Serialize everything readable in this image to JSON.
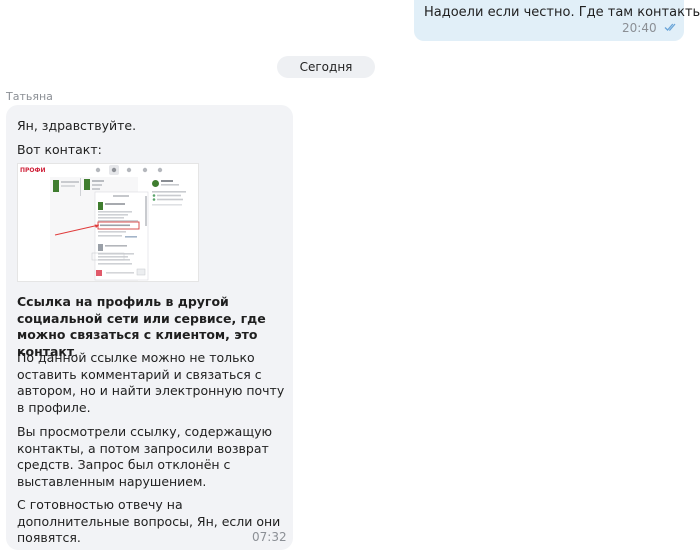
{
  "outgoing": {
    "text": "Надоели если честно. Где там контакты?",
    "time": "20:40",
    "status_icon": "double-check-icon",
    "bubble_color": "#e1eff8",
    "check_color": "#6aa5d8"
  },
  "date_divider": "Сегодня",
  "incoming": {
    "sender": "Татьяна",
    "greeting": "Ян, здравствуйте.",
    "intro": "Вот контакт:",
    "image": {
      "brand": "ПРОФИ",
      "accent_color": "#d0233b"
    },
    "bold_paragraph": "Ссылка на профиль в другой социальной сети или сервисе, где можно связаться с клиентом, это контакт",
    "bold_suffix": ".",
    "paragraph_1": "По данной ссылке можно не только оставить комментарий и связаться с автором, но и найти электронную почту в профиле.",
    "paragraph_2": "Вы просмотрели ссылку, содержащую контакты, а потом запросили возврат средств. Запрос был отклонён с выставленным нарушением.",
    "paragraph_3": "С готовностью отвечу на дополнительные вопросы, Ян, если они появятся.",
    "time": "07:32",
    "bubble_color": "#f2f3f6"
  }
}
